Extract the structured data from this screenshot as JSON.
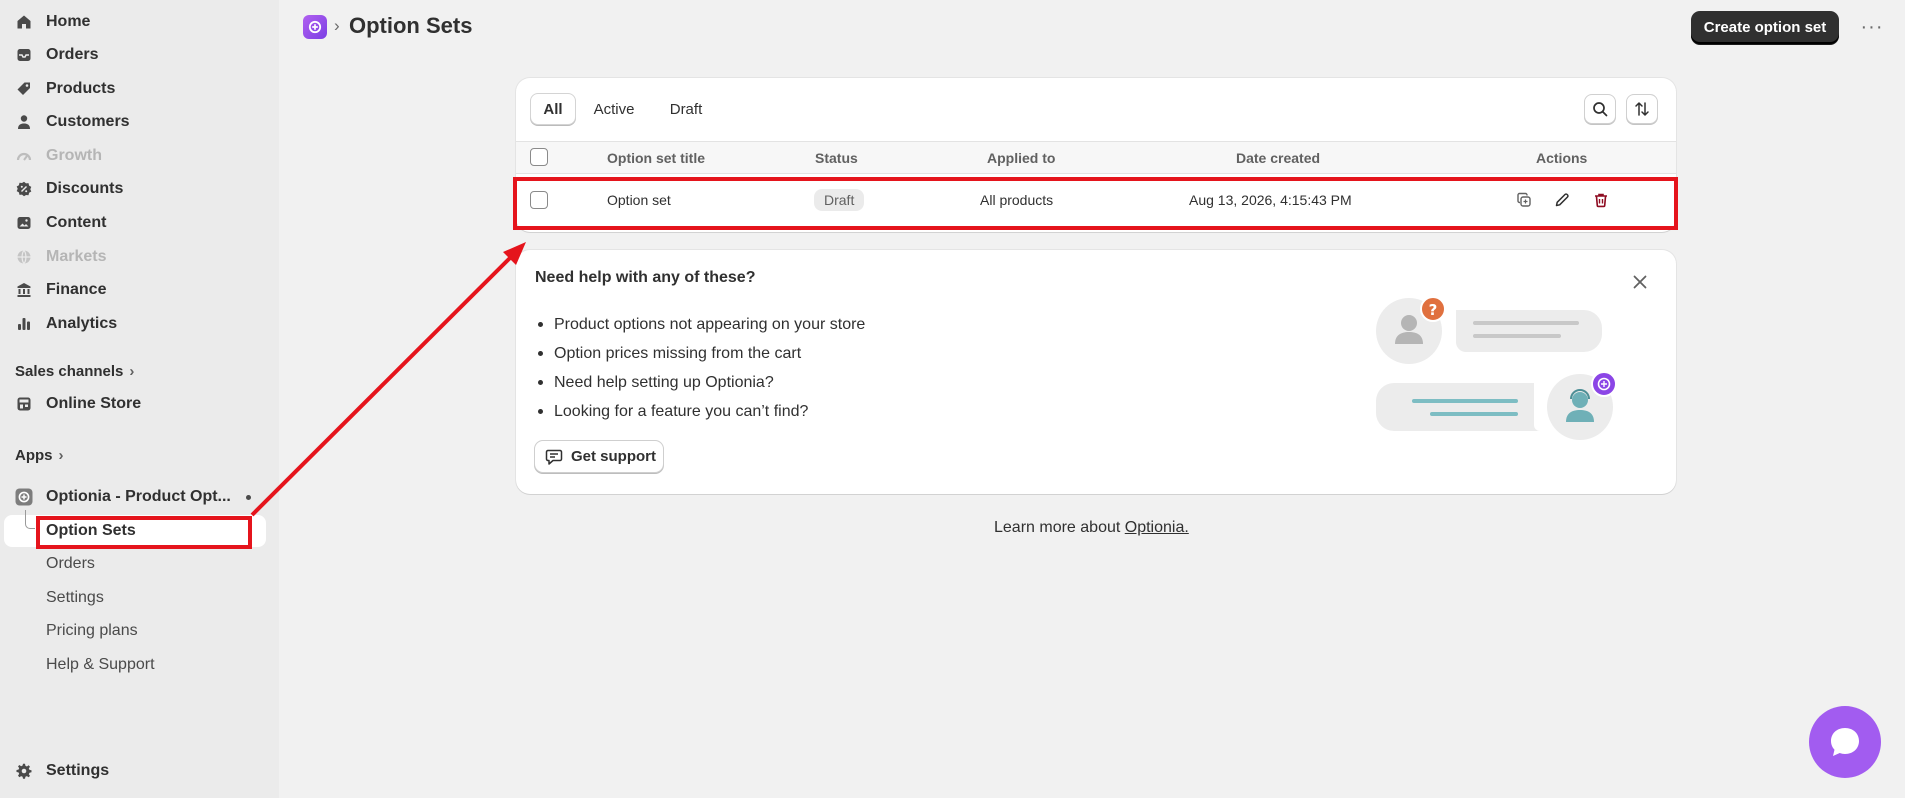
{
  "sidebar": {
    "items": [
      {
        "label": "Home",
        "icon": "home-icon",
        "disabled": false
      },
      {
        "label": "Orders",
        "icon": "orders-inbox-icon",
        "disabled": false
      },
      {
        "label": "Products",
        "icon": "tag-icon",
        "disabled": false
      },
      {
        "label": "Customers",
        "icon": "person-icon",
        "disabled": false
      },
      {
        "label": "Growth",
        "icon": "gauge-icon",
        "disabled": true
      },
      {
        "label": "Discounts",
        "icon": "discount-icon",
        "disabled": false
      },
      {
        "label": "Content",
        "icon": "image-icon",
        "disabled": false
      },
      {
        "label": "Markets",
        "icon": "globe-icon",
        "disabled": true
      },
      {
        "label": "Finance",
        "icon": "bank-icon",
        "disabled": false
      },
      {
        "label": "Analytics",
        "icon": "bar-chart-icon",
        "disabled": false
      }
    ],
    "sales_channels_label": "Sales channels",
    "online_store_label": "Online Store",
    "apps_label": "Apps",
    "app_name": "Optionia - Product Opt...",
    "app_subitems": [
      "Option Sets",
      "Orders",
      "Settings",
      "Pricing plans",
      "Help & Support"
    ],
    "settings_label": "Settings"
  },
  "header": {
    "breadcrumb_separator": "›",
    "title": "Option Sets",
    "primary_button": "Create option set",
    "more_label": "···"
  },
  "table": {
    "tabs": [
      "All",
      "Active",
      "Draft"
    ],
    "columns": [
      "Option set title",
      "Status",
      "Applied to",
      "Date created",
      "Actions"
    ],
    "rows": [
      {
        "title": "Option set",
        "status": "Draft",
        "applied_to": "All products",
        "date_created": "Aug 13, 2026, 4:15:43 PM"
      }
    ]
  },
  "help": {
    "title": "Need help with any of these?",
    "items": [
      "Product options not appearing on your store",
      "Option prices missing from the cart",
      "Need help setting up Optionia?",
      "Looking for a feature you can’t find?"
    ],
    "button": "Get support"
  },
  "footer": {
    "learn_text": "Learn more about ",
    "learn_link": "Optionia."
  },
  "colors": {
    "annotation": "#e5141c",
    "brand": "#a25cf0",
    "delete": "#8e0b21"
  }
}
